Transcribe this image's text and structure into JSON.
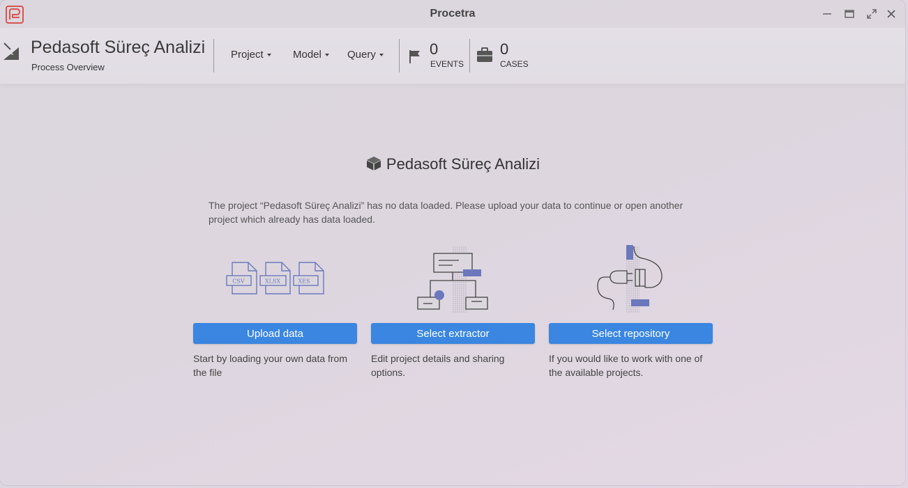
{
  "window": {
    "title": "Procetra",
    "controls": [
      "minimize-icon",
      "maximize-icon",
      "fullscreen-icon",
      "close-icon"
    ]
  },
  "header": {
    "project_name": "Pedasoft Süreç Analizi",
    "project_subtitle": "Process Overview",
    "menus": [
      "Project",
      "Model",
      "Query"
    ],
    "events": {
      "value": "0",
      "label": "EVENTS",
      "icon": "flag-icon"
    },
    "cases": {
      "value": "0",
      "label": "CASES",
      "icon": "briefcase-icon"
    }
  },
  "main": {
    "title": "Pedasoft Süreç Analizi",
    "description": "The project “Pedasoft Süreç Analizi” has no data loaded. Please upload your data to continue or open another project which already has data loaded.",
    "file_types": [
      "CSV",
      "XLSX",
      "XES"
    ],
    "cards": [
      {
        "button": "Upload data",
        "text": "Start by loading your own data from the file"
      },
      {
        "button": "Select extractor",
        "text": "Edit project details and sharing options."
      },
      {
        "button": "Select repository",
        "text": "If you would like to work with one of the available projects."
      }
    ]
  },
  "colors": {
    "accent": "#3a86e0",
    "illustration": "#6b78bd",
    "logo": "#d9534f"
  }
}
